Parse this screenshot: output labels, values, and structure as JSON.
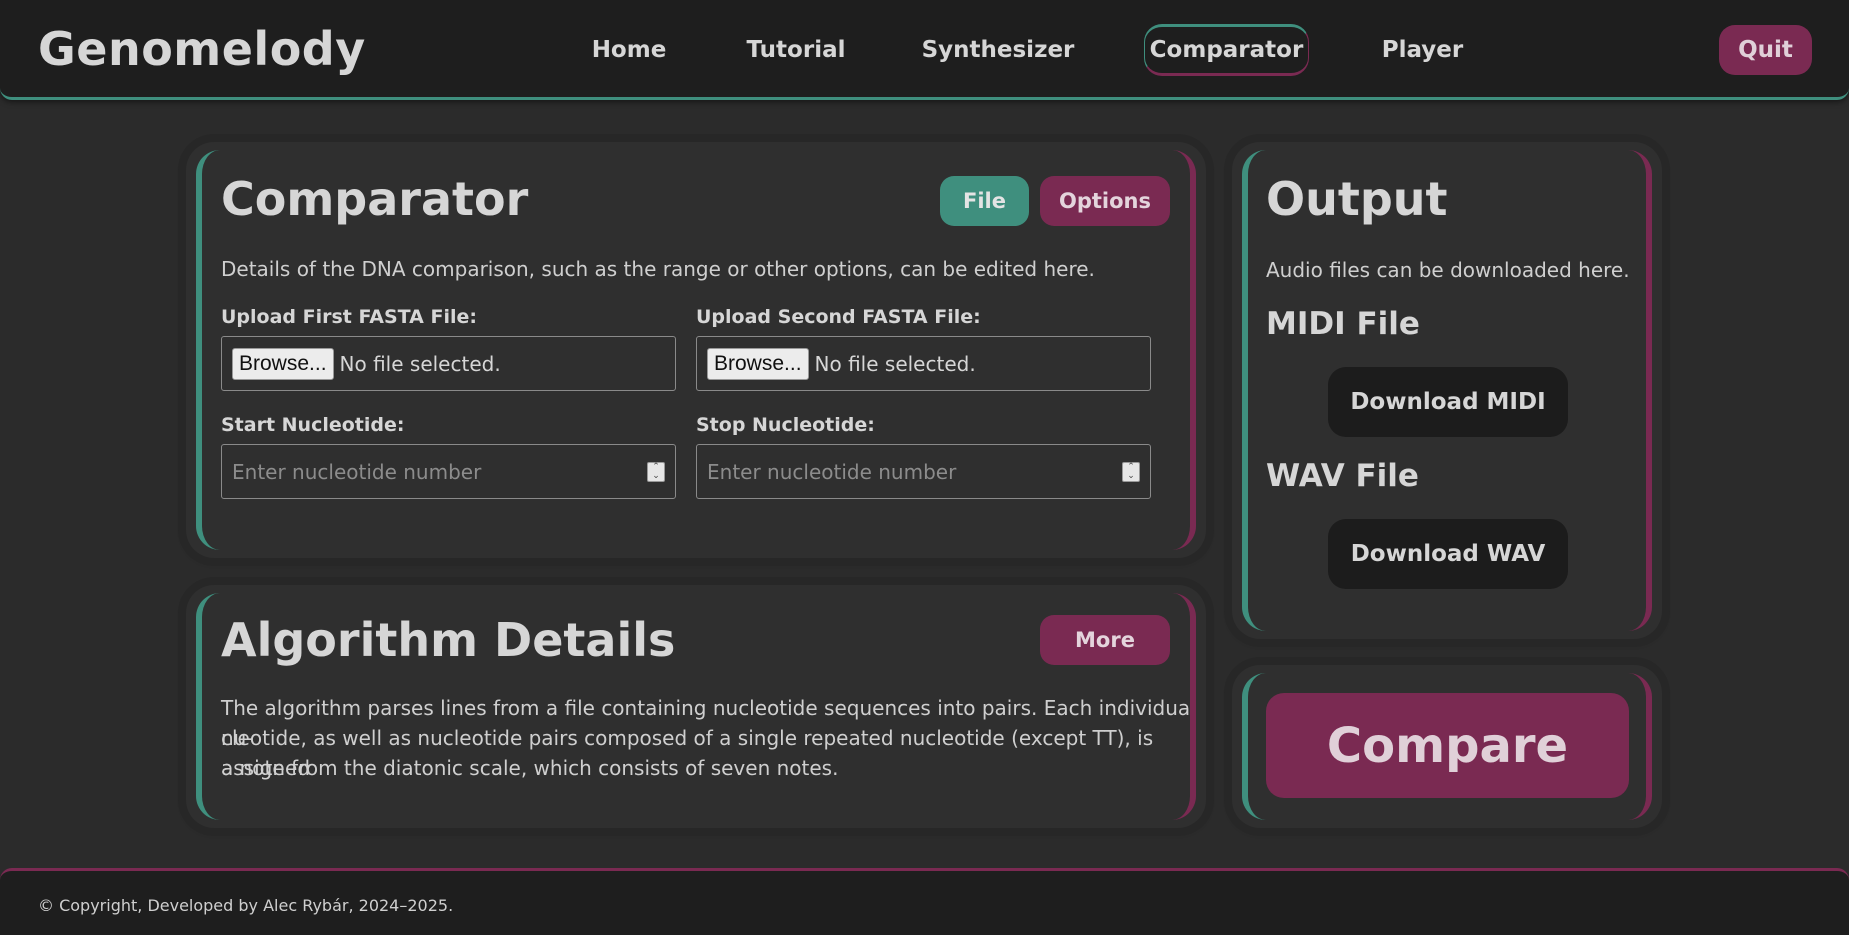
{
  "header": {
    "brand": "Genomelody",
    "nav": [
      {
        "label": "Home"
      },
      {
        "label": "Tutorial"
      },
      {
        "label": "Synthesizer"
      },
      {
        "label": "Comparator",
        "active": true
      },
      {
        "label": "Player"
      }
    ],
    "quit_label": "Quit"
  },
  "comparator": {
    "title": "Comparator",
    "file_label": "File",
    "options_label": "Options",
    "description": "Details of the DNA comparison, such as the range or other options, can be edited here.",
    "first_file": {
      "label": "Upload First FASTA File:",
      "browse": "Browse...",
      "status": "No file selected."
    },
    "second_file": {
      "label": "Upload Second FASTA File:",
      "browse": "Browse...",
      "status": "No file selected."
    },
    "start": {
      "label": "Start Nucleotide:",
      "placeholder": "Enter nucleotide number"
    },
    "stop": {
      "label": "Stop Nucleotide:",
      "placeholder": "Enter nucleotide number"
    }
  },
  "algorithm": {
    "title": "Algorithm Details",
    "more_label": "More",
    "lines": [
      "The algorithm parses lines from a file containing nucleotide sequences into pairs. Each individual nu-",
      "cleotide, as well as nucleotide pairs composed of a single repeated nucleotide (except TT), is assigned",
      "a note from the diatonic scale, which consists of seven notes."
    ]
  },
  "output": {
    "title": "Output",
    "description": "Audio files can be downloaded here.",
    "midi_heading": "MIDI File",
    "midi_button": "Download MIDI",
    "wav_heading": "WAV File",
    "wav_button": "Download WAV"
  },
  "compare_label": "Compare",
  "footer": {
    "text": "© Copyright, Developed by Alec Rybár, 2024–2025."
  },
  "colors": {
    "accent_green": "#3f8f7e",
    "accent_purple": "#7a2a52",
    "background": "#2b2b2b",
    "card": "#2f2f2f"
  }
}
